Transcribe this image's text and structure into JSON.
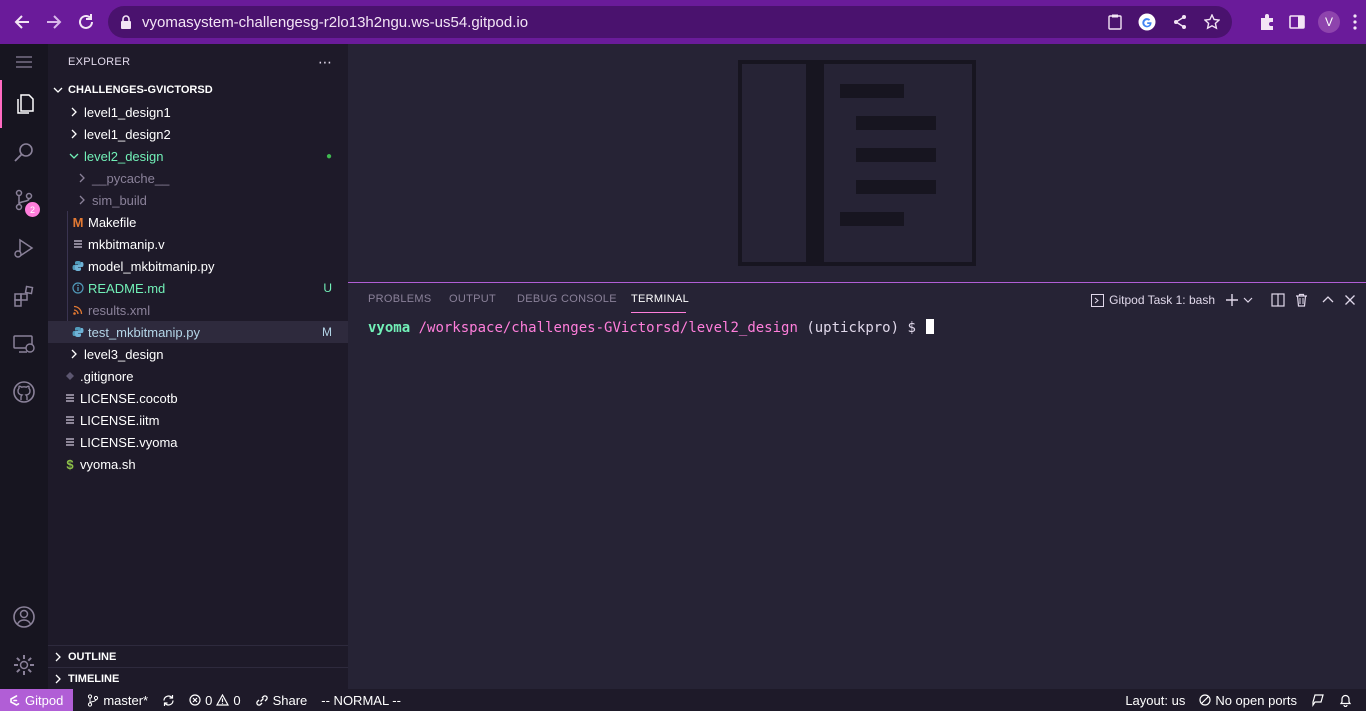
{
  "browser": {
    "url": "vyomasystem-challengesg-r2lo13h2ngu.ws-us54.gitpod.io",
    "profile_initial": "V"
  },
  "activity_bar": {
    "scm_badge": "2"
  },
  "explorer": {
    "title": "EXPLORER",
    "more": "⋯",
    "root": "CHALLENGES-GVICTORSD",
    "items": [
      {
        "label": "level1_design1",
        "decor": ""
      },
      {
        "label": "level1_design2",
        "decor": ""
      },
      {
        "label": "level2_design",
        "decor": "●"
      },
      {
        "label": "__pycache__",
        "decor": ""
      },
      {
        "label": "sim_build",
        "decor": ""
      },
      {
        "label": "Makefile",
        "decor": ""
      },
      {
        "label": "mkbitmanip.v",
        "decor": ""
      },
      {
        "label": "model_mkbitmanip.py",
        "decor": ""
      },
      {
        "label": "README.md",
        "decor": "U"
      },
      {
        "label": "results.xml",
        "decor": ""
      },
      {
        "label": "test_mkbitmanip.py",
        "decor": "M"
      },
      {
        "label": "level3_design",
        "decor": ""
      },
      {
        "label": ".gitignore",
        "decor": ""
      },
      {
        "label": "LICENSE.cocotb",
        "decor": ""
      },
      {
        "label": "LICENSE.iitm",
        "decor": ""
      },
      {
        "label": "LICENSE.vyoma",
        "decor": ""
      },
      {
        "label": "vyoma.sh",
        "decor": ""
      }
    ],
    "outline": "OUTLINE",
    "timeline": "TIMELINE"
  },
  "panel": {
    "tabs": [
      "PROBLEMS",
      "OUTPUT",
      "DEBUG CONSOLE",
      "TERMINAL"
    ],
    "active_tab": "TERMINAL",
    "terminal_name": "Gitpod Task 1: bash",
    "prompt": {
      "user": "vyoma",
      "path": "/workspace/challenges-GVictorsd/level2_design",
      "env": "(uptickpro)",
      "symbol": "$"
    }
  },
  "statusbar": {
    "gitpod": "Gitpod",
    "branch": "master*",
    "errors": "0",
    "warnings": "0",
    "share": "Share",
    "mode": "-- NORMAL --",
    "layout": "Layout: us",
    "ports": "No open ports"
  },
  "colors": {
    "accent": "#b15ed6",
    "browser_bar": "#6a1b9a",
    "git_added": "#72f1b8",
    "git_modified": "#ffffff"
  }
}
